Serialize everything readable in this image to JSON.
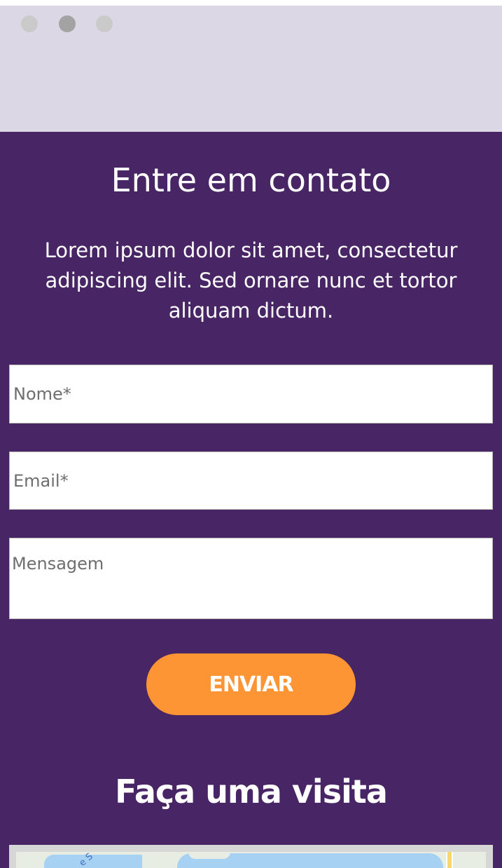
{
  "carousel": {
    "dots": [
      "dot-1",
      "dot-2",
      "dot-3"
    ],
    "active_index": 1
  },
  "contact": {
    "title": "Entre em contato",
    "description": "Lorem ipsum dolor sit amet, consectetur adipiscing elit. Sed ornare nunc et tortor aliquam dictum.",
    "name_placeholder": "Nome*",
    "email_placeholder": "Email*",
    "message_placeholder": "Mensagem",
    "send_label": "ENVIAR"
  },
  "visit": {
    "title": "Faça uma visita",
    "map_label_fragment": "e S"
  },
  "colors": {
    "band": "#dcd7e4",
    "purple": "#482564",
    "orange": "#fd9535"
  }
}
